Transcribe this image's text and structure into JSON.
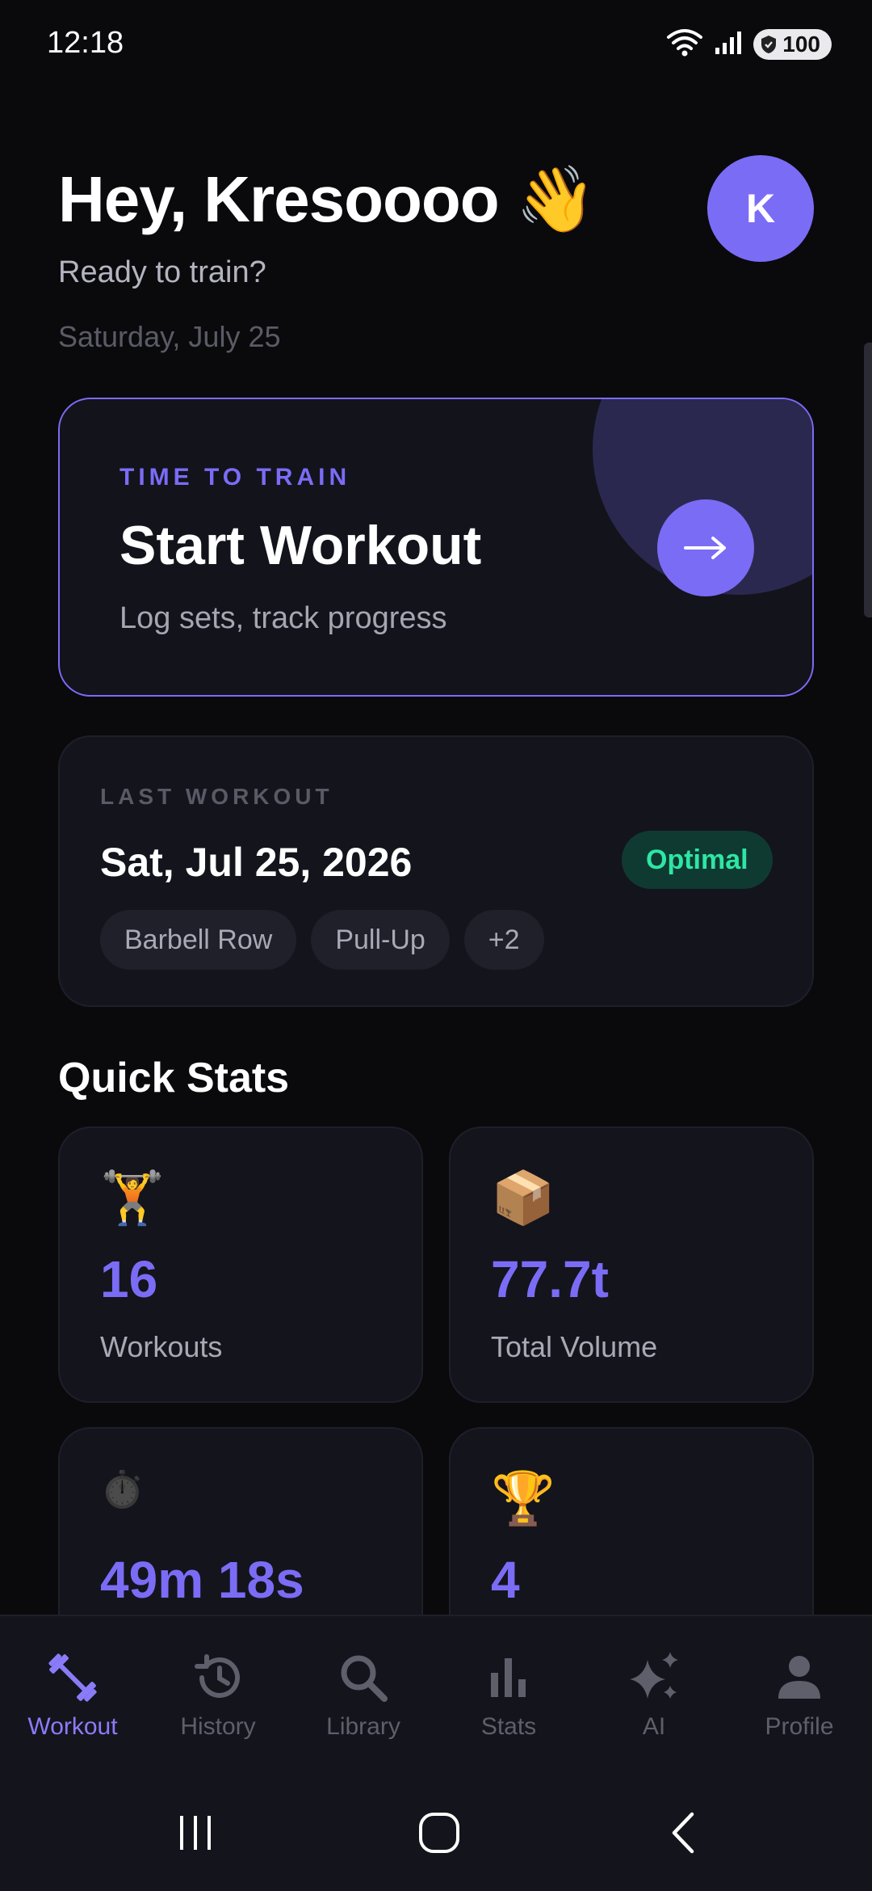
{
  "status_bar": {
    "time": "12:18",
    "battery": "100"
  },
  "header": {
    "greeting": "Hey, Kresoooo 👋",
    "subtitle": "Ready to train?",
    "date": "Saturday, July 25",
    "avatar_initial": "K"
  },
  "start_card": {
    "eyebrow": "TIME TO TRAIN",
    "title": "Start Workout",
    "subtitle": "Log sets, track progress",
    "arrow": "→"
  },
  "last_workout": {
    "eyebrow": "LAST WORKOUT",
    "date": "Sat, Jul 25, 2026",
    "status": "Optimal",
    "chips": [
      "Barbell Row",
      "Pull-Up",
      "+2"
    ]
  },
  "quick_stats": {
    "title": "Quick Stats",
    "items": [
      {
        "icon": "🏋️",
        "value": "16",
        "label": "Workouts"
      },
      {
        "icon": "📦",
        "value": "77.7t",
        "label": "Total Volume"
      },
      {
        "icon": "⏱️",
        "value": "49m 18s",
        "label": ""
      },
      {
        "icon": "🏆",
        "value": "4",
        "label": ""
      }
    ]
  },
  "nav": {
    "items": [
      {
        "label": "Workout",
        "icon": "dumbbell-icon",
        "active": true
      },
      {
        "label": "History",
        "icon": "history-icon",
        "active": false
      },
      {
        "label": "Library",
        "icon": "search-icon",
        "active": false
      },
      {
        "label": "Stats",
        "icon": "bar-chart-icon",
        "active": false
      },
      {
        "label": "AI",
        "icon": "sparkles-icon",
        "active": false
      },
      {
        "label": "Profile",
        "icon": "person-icon",
        "active": false
      }
    ]
  },
  "colors": {
    "accent": "#7b6cf6",
    "background": "#0a0a0d",
    "card": "#14141d",
    "success": "#2ee6a3"
  }
}
